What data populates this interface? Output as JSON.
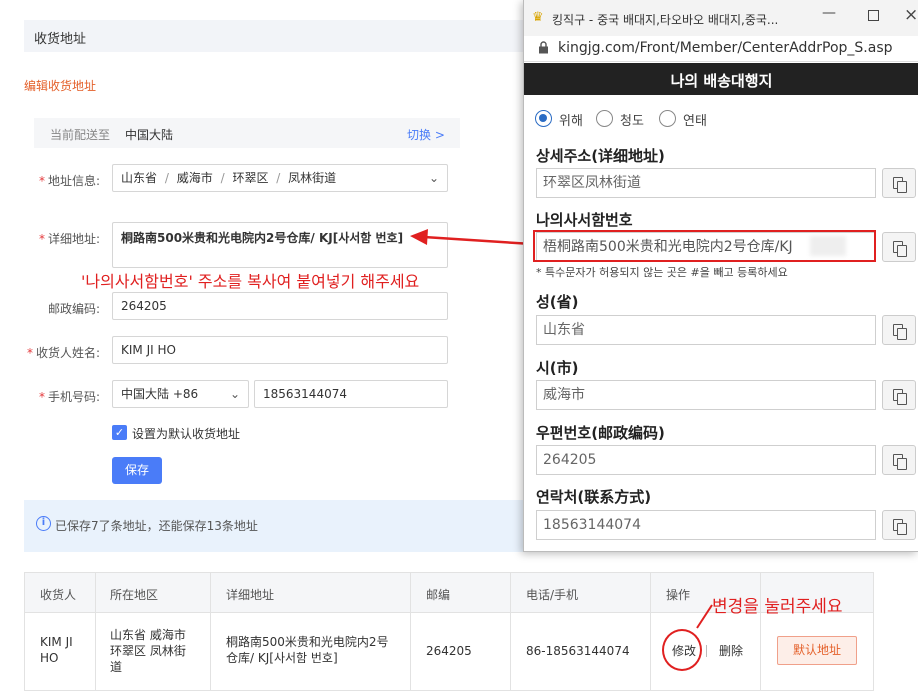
{
  "page": {
    "section_title": "收货地址",
    "edit_title": "编辑收货地址",
    "ship_to_label": "当前配送至",
    "ship_to_value": "中国大陆",
    "switch_link": "切换 >",
    "address_info_label": "地址信息:",
    "region": {
      "province": "山东省",
      "city": "威海市",
      "district": "环翠区",
      "street": "凤林街道",
      "sep": "/"
    },
    "detail_label": "详细地址:",
    "detail_value": "桐路南500米贵和光电院内2号仓库/ KJ[사서함 번호]",
    "korean_note": "'나의사서함번호' 주소를 복사여 붙여넣기 해주세요",
    "postal_label": "邮政编码:",
    "postal_value": "264205",
    "name_label": "收货人姓名:",
    "name_value": "KIM JI HO",
    "phone_label": "手机号码:",
    "phone_country": "中国大陆 +86",
    "phone_value": "18563144074",
    "default_checkbox": "设置为默认收货地址",
    "save_button": "保存",
    "info_text": "已保存7了条地址，还能保存13条地址",
    "table": {
      "headers": [
        "收货人",
        "所在地区",
        "详细地址",
        "邮编",
        "电话/手机",
        "操作"
      ],
      "row": {
        "receiver": "KIM JI HO",
        "region": "山东省 威海市 环翠区 凤林街道",
        "address": "桐路南500米贵和光电院内2号仓库/ KJ[사서함 번호]",
        "zip": "264205",
        "phone": "86-18563144074",
        "edit": "修改",
        "delete": "删除",
        "default_btn": "默认地址"
      }
    },
    "edit_note": "변경을 눌러주세요"
  },
  "popup": {
    "title_bar": "킹직구 - 중국 배대지,타오바오 배대지,중국...",
    "url": "kingjg.com/Front/Member/CenterAddrPop_S.asp",
    "header": "나의 배송대행지",
    "radios": [
      {
        "label": "위해",
        "checked": true
      },
      {
        "label": "청도",
        "checked": false
      },
      {
        "label": "연태",
        "checked": false
      }
    ],
    "fields": [
      {
        "label": "상세주소(详细地址)",
        "value": "环翠区凤林街道"
      },
      {
        "label": "나의사서함번호",
        "value": "梧桐路南500米贵和光电院内2号仓库/KJ"
      },
      {
        "label": "성(省)",
        "value": "山东省"
      },
      {
        "label": "시(市)",
        "value": "威海市"
      },
      {
        "label": "우편번호(邮政编码)",
        "value": "264205"
      },
      {
        "label": "연락처(联系方式)",
        "value": "18563144074"
      }
    ],
    "warning": "* 특수문자가 허용되지 않는 곳은 #을 빼고 등록하세요"
  },
  "colors": {
    "accent": "#4a7cf8",
    "annotation_red": "#e02020",
    "popup_header": "#222222",
    "label_orange": "#e4602a"
  }
}
